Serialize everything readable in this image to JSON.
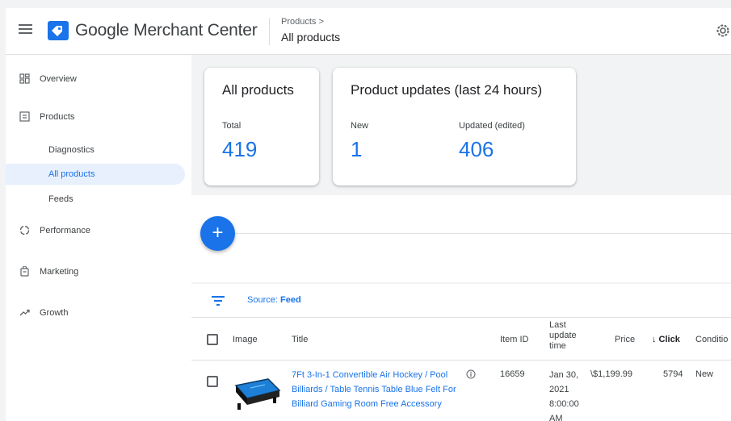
{
  "header": {
    "brand": "Google Merchant Center",
    "breadcrumb_parent": "Products >",
    "breadcrumb_current": "All products"
  },
  "sidebar": {
    "items": [
      {
        "label": "Overview",
        "icon": "dashboard-icon"
      },
      {
        "label": "Products",
        "icon": "products-icon"
      },
      {
        "label": "Diagnostics"
      },
      {
        "label": "All products",
        "active": true
      },
      {
        "label": "Feeds"
      },
      {
        "label": "Performance",
        "icon": "performance-icon"
      },
      {
        "label": "Marketing",
        "icon": "marketing-icon"
      },
      {
        "label": "Growth",
        "icon": "growth-icon"
      }
    ]
  },
  "cards": {
    "all_products": {
      "title": "All products",
      "total_label": "Total",
      "total_value": "419"
    },
    "updates": {
      "title": "Product updates (last 24 hours)",
      "new_label": "New",
      "new_value": "1",
      "updated_label": "Updated (edited)",
      "updated_value": "406"
    }
  },
  "fab": {
    "label": "+"
  },
  "filter": {
    "prefix": "Source:",
    "value": "Feed"
  },
  "table": {
    "columns": {
      "image": "Image",
      "title": "Title",
      "item_id": "Item ID",
      "last_update": [
        "Last",
        "update",
        "time"
      ],
      "price": "Price",
      "clicks": "↓ Click",
      "condition": "Conditio"
    },
    "rows": [
      {
        "title": "7Ft 3-In-1 Convertible Air Hockey / Pool Billiards / Table Tennis Table Blue Felt For Billiard Gaming Room Free Accessory",
        "item_id": "16659",
        "last_update": [
          "Jan 30,",
          "2021",
          "8:00:00",
          "AM"
        ],
        "price": "\\$1,199.99",
        "clicks": "5794",
        "condition": "New"
      }
    ]
  },
  "colors": {
    "accent": "#1a73e8",
    "active_nav_bg": "#e8f0fe",
    "background": "#f1f3f4"
  }
}
